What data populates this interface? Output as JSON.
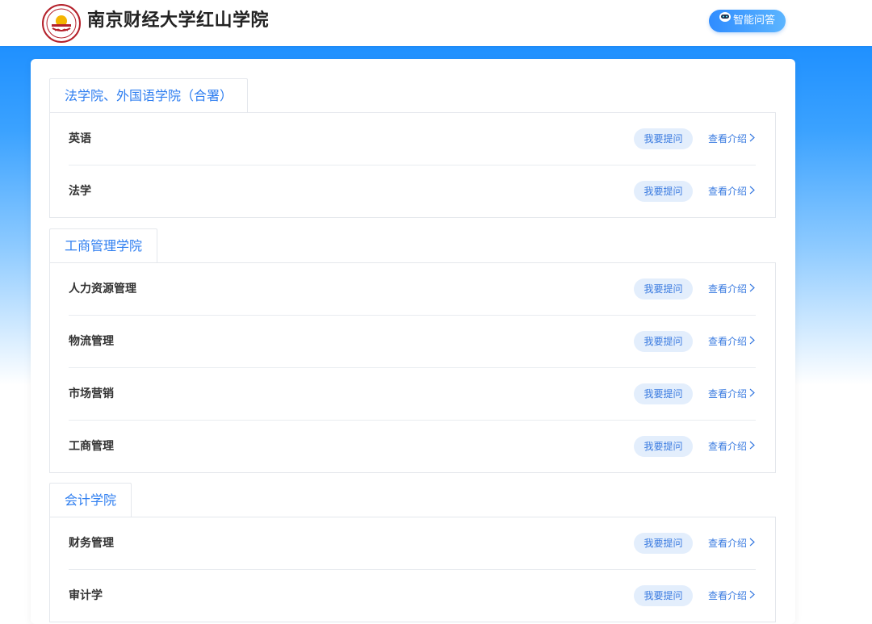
{
  "header": {
    "school_name": "南京财经大学红山学院",
    "ai_button_label": "智能问答",
    "ai_icon": "robot-icon",
    "logo_icon": "school-emblem-icon"
  },
  "theme": {
    "accent": "#2e7ef0",
    "button_bg": "#e3eefc"
  },
  "sections": [
    {
      "tab_label": "法学院、外国语学院（合署）",
      "rows": [
        {
          "major": "英语",
          "ask_label": "我要提问",
          "intro_label": "查看介绍"
        },
        {
          "major": "法学",
          "ask_label": "我要提问",
          "intro_label": "查看介绍"
        }
      ]
    },
    {
      "tab_label": "工商管理学院",
      "rows": [
        {
          "major": "人力资源管理",
          "ask_label": "我要提问",
          "intro_label": "查看介绍"
        },
        {
          "major": "物流管理",
          "ask_label": "我要提问",
          "intro_label": "查看介绍"
        },
        {
          "major": "市场营销",
          "ask_label": "我要提问",
          "intro_label": "查看介绍"
        },
        {
          "major": "工商管理",
          "ask_label": "我要提问",
          "intro_label": "查看介绍"
        }
      ]
    },
    {
      "tab_label": "会计学院",
      "rows": [
        {
          "major": "财务管理",
          "ask_label": "我要提问",
          "intro_label": "查看介绍"
        },
        {
          "major": "审计学",
          "ask_label": "我要提问",
          "intro_label": "查看介绍"
        }
      ]
    }
  ]
}
